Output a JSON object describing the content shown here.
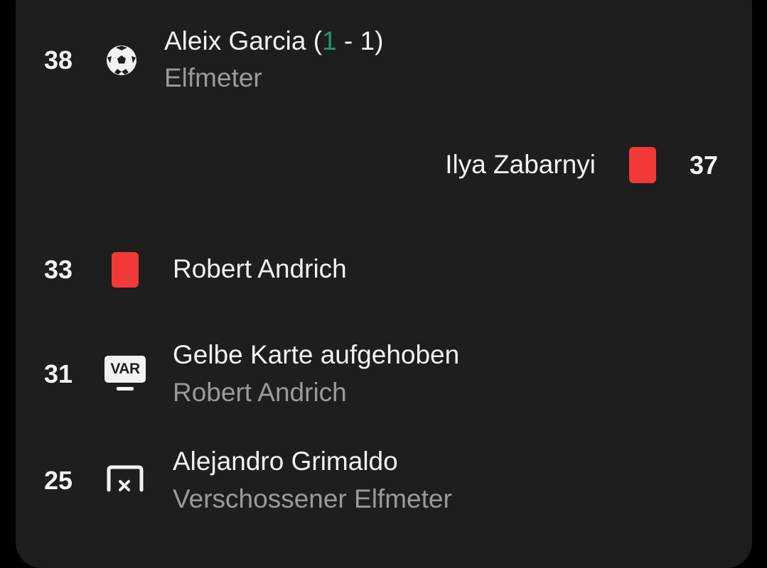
{
  "events": [
    {
      "minute": "38",
      "icon": "soccer-ball-icon",
      "player": "Aleix Garcia",
      "score_open": " (",
      "score_home": "1",
      "score_rest": " - 1)",
      "detail": "Elfmeter",
      "side": "left"
    },
    {
      "minute": "37",
      "icon": "red-card-icon",
      "player": "Ilya Zabarnyi",
      "side": "right"
    },
    {
      "minute": "33",
      "icon": "red-card-icon",
      "player": "Robert Andrich",
      "side": "left"
    },
    {
      "minute": "31",
      "icon": "var-icon",
      "icon_text": "VAR",
      "title": "Gelbe Karte aufgehoben",
      "detail": "Robert Andrich",
      "side": "left"
    },
    {
      "minute": "25",
      "icon": "missed-penalty-icon",
      "player": "Alejandro Grimaldo",
      "detail": "Verschossener Elfmeter",
      "side": "left"
    }
  ],
  "colors": {
    "background": "#000000",
    "card": "#1e1e1e",
    "text_primary": "#f2f2f2",
    "text_secondary": "#9a9a9a",
    "score_highlight": "#1f9a6a",
    "red_card": "#f23a36"
  }
}
